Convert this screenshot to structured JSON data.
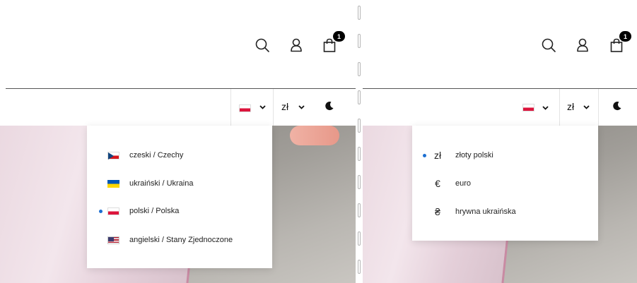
{
  "header": {
    "cart_count": "1",
    "icons": [
      "search-icon",
      "user-icon",
      "bag-icon"
    ]
  },
  "left_panel": {
    "toolbar": {
      "country_flag": "pl",
      "currency_label": "zł",
      "theme_icon": "moon-icon"
    },
    "country_dropdown": {
      "items": [
        {
          "flag": "cz",
          "label": "czeski / Czechy",
          "selected": false
        },
        {
          "flag": "ua",
          "label": "ukraiński / Ukraina",
          "selected": false
        },
        {
          "flag": "pl",
          "label": "polski / Polska",
          "selected": true
        },
        {
          "flag": "us",
          "label": "angielski / Stany Zjednoczone",
          "selected": false
        }
      ]
    }
  },
  "right_panel": {
    "toolbar": {
      "country_flag": "pl",
      "currency_label": "zł",
      "theme_icon": "moon-icon"
    },
    "currency_dropdown": {
      "items": [
        {
          "symbol": "zł",
          "label": "złoty polski",
          "selected": true
        },
        {
          "symbol": "€",
          "label": "euro",
          "selected": false
        },
        {
          "symbol": "₴",
          "label": "hrywna ukraińska",
          "selected": false
        }
      ]
    }
  },
  "colors": {
    "accent_dot": "#1d6fd1",
    "badge": "#000000",
    "divider_line": "#555555"
  }
}
